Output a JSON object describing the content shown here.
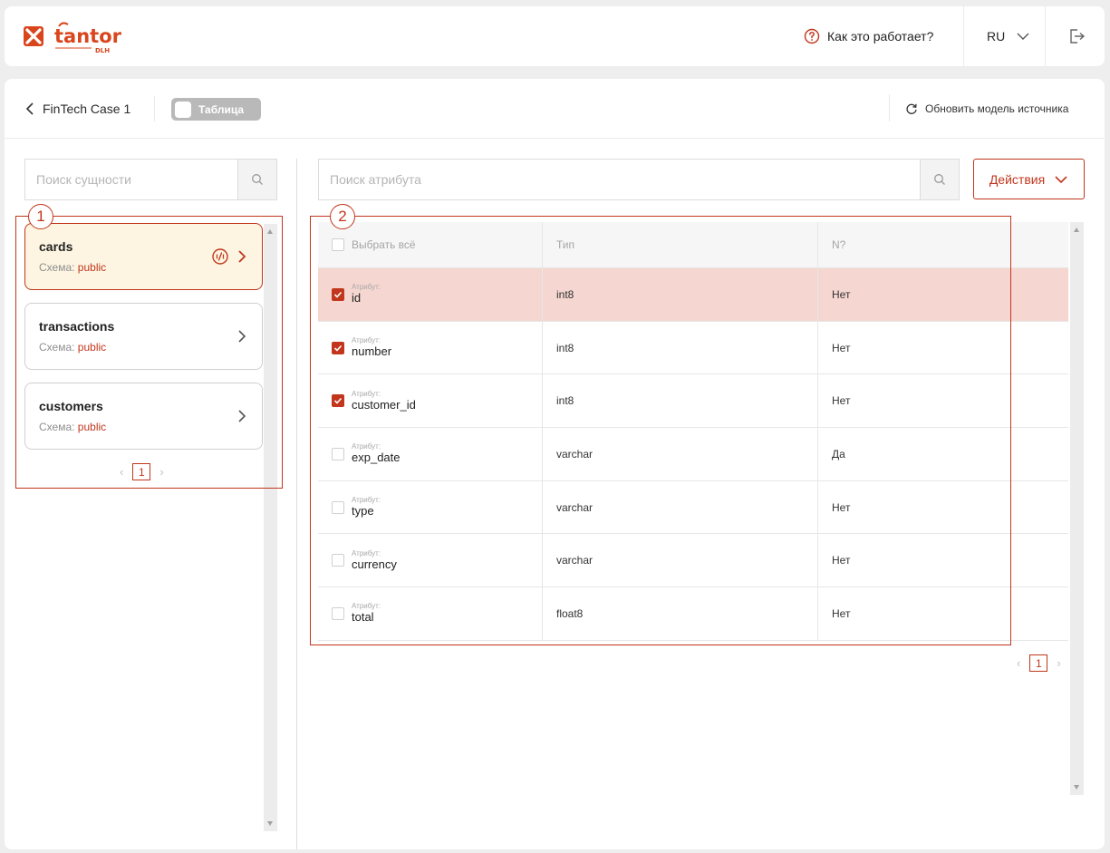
{
  "header": {
    "logo_text": "tantor",
    "logo_sub": "DLH",
    "help_label": "Как это работает?",
    "lang": "RU"
  },
  "toolbar": {
    "back_label": "FinTech Case 1",
    "toggle_label": "Таблица",
    "refresh_label": "Обновить модель источника"
  },
  "entities": {
    "search_placeholder": "Поиск сущности",
    "schema_prefix": "Схема: ",
    "items": [
      {
        "name": "cards",
        "schema": "public",
        "active": true
      },
      {
        "name": "transactions",
        "schema": "public",
        "active": false
      },
      {
        "name": "customers",
        "schema": "public",
        "active": false
      }
    ],
    "page": "1"
  },
  "attributes": {
    "search_placeholder": "Поиск атрибута",
    "actions_label": "Действия",
    "columns": {
      "select_all": "Выбрать всё",
      "type": "Тип",
      "nullable": "N?"
    },
    "attr_label": "Атрибут:",
    "rows": [
      {
        "name": "id",
        "type": "int8",
        "nullable": "Нет",
        "checked": true
      },
      {
        "name": "number",
        "type": "int8",
        "nullable": "Нет",
        "checked": true
      },
      {
        "name": "customer_id",
        "type": "int8",
        "nullable": "Нет",
        "checked": true
      },
      {
        "name": "exp_date",
        "type": "varchar",
        "nullable": "Да",
        "checked": false
      },
      {
        "name": "type",
        "type": "varchar",
        "nullable": "Нет",
        "checked": false
      },
      {
        "name": "currency",
        "type": "varchar",
        "nullable": "Нет",
        "checked": false
      },
      {
        "name": "total",
        "type": "float8",
        "nullable": "Нет",
        "checked": false
      }
    ],
    "page": "1"
  },
  "annotations": {
    "one": "1",
    "two": "2"
  },
  "colors": {
    "accent": "#c1361c",
    "active_bg": "#fdf5e1",
    "highlight_row": "#f5d6d0"
  }
}
